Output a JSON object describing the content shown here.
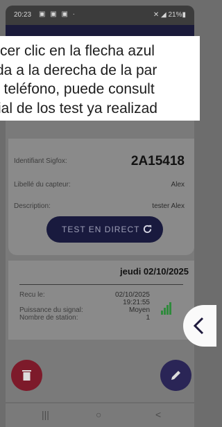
{
  "status": {
    "time": "20:23",
    "battery": "21%"
  },
  "caption": {
    "lines": [
      "cer clic en la flecha azul",
      "da a la derecha de la par",
      "u teléfono, puede consult",
      "rial de los test ya realizad"
    ]
  },
  "sensor": {
    "sigfox_label": "Identifiant Sigfox:",
    "sigfox_value": "2A15418",
    "libelle_label": "Libellé du capteur:",
    "libelle_value": "Alex",
    "desc_label": "Description:",
    "desc_value": "tester Alex",
    "test_button": "TEST EN DIRECT"
  },
  "test": {
    "date": "jeudi 02/10/2025",
    "recu_label": "Recu le:",
    "recu_date": "02/10/2025",
    "recu_time": "19:21:55",
    "puissance_label": "Puissance du signal:",
    "puissance_value": "Moyen",
    "stations_label": "Nombre de station:",
    "stations_value": "1"
  },
  "colors": {
    "accent": "#191a3e",
    "delete": "#7d1a2a",
    "signal": "#2f8a3c"
  },
  "nav": {
    "recent": "|||",
    "home": "○",
    "back": "<"
  }
}
